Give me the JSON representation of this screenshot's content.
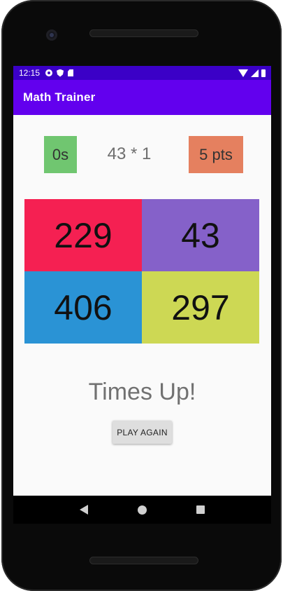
{
  "status_bar": {
    "time": "12:15",
    "icons_left": [
      "gear-icon",
      "shield-icon",
      "sdcard-icon"
    ],
    "icons_right": [
      "wifi-icon",
      "signal-icon",
      "battery-icon"
    ]
  },
  "app_bar": {
    "title": "Math Trainer"
  },
  "game": {
    "timer": "0s",
    "question": "43 * 1",
    "score": "5 pts",
    "answers": [
      {
        "value": "229",
        "color": "#f52052"
      },
      {
        "value": "43",
        "color": "#8561c9"
      },
      {
        "value": "406",
        "color": "#2a93d5"
      },
      {
        "value": "297",
        "color": "#cdd854"
      }
    ],
    "result": "Times Up!",
    "play_again_label": "PLAY AGAIN"
  },
  "colors": {
    "status_bar": "#3b00c7",
    "app_bar": "#6200ee",
    "timer_bg": "#70c670",
    "score_bg": "#e5805f"
  },
  "nav_bar": {
    "buttons": [
      "back-icon",
      "home-icon",
      "recents-icon"
    ]
  }
}
